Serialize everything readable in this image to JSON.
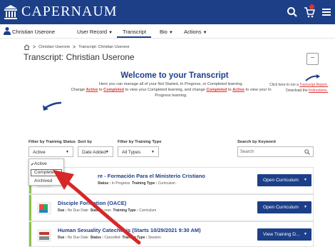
{
  "header": {
    "app_title": "CAPERNAUM",
    "colors": {
      "brand": "#1c3f88",
      "accent": "#e03131",
      "status_green": "#8bc34a"
    }
  },
  "subnav": {
    "user_name": "Christian Userone",
    "items": [
      {
        "label": "User Record",
        "has_menu": true
      },
      {
        "label": "Transcript",
        "has_menu": false
      },
      {
        "label": "Bio",
        "has_menu": true
      },
      {
        "label": "Actions",
        "has_menu": true
      }
    ]
  },
  "breadcrumb": {
    "items": [
      "Christian Userone",
      "Transcript: Christian Userone"
    ]
  },
  "page": {
    "title": "Transcript: Christian Userone",
    "collapse_label": "−"
  },
  "welcome": {
    "title": "Welcome to your Transcript",
    "line1": "Here you can manage all of your Not Started, In Progress, or Completed learning.",
    "p1": "Change ",
    "active": "Active",
    "p2": " to ",
    "completed": "Completed",
    "p3": " to view your Completed learning, and change ",
    "completed2": "Completed",
    "p4": " to ",
    "active2": "Active",
    "p5": " to view your In Progress learning.",
    "side_1": "Click here to run a ",
    "side_link1": "Transcript Report.",
    "side_2": "Download the ",
    "side_link2": "Instructions."
  },
  "filters": {
    "status_label": "Filter by Training Status",
    "status_value": "Active",
    "sort_label": "Sort by",
    "sort_value": "Date Added",
    "type_label": "Filter by Training Type",
    "type_value": "All Types",
    "search_label": "Search by Keyword",
    "search_placeholder": "Search"
  },
  "status_dropdown": {
    "options": [
      "Active",
      "Completed",
      "Archived"
    ],
    "selected": "Active"
  },
  "rows": [
    {
      "title": "re - Formación Para el Ministerio Cristiano",
      "due_label": "Due :",
      "due_value": "",
      "status_label": "Status :",
      "status_value": "In Progress",
      "type_label": "Training Type :",
      "type_value": "Curriculum",
      "button": "Open Curriculum"
    },
    {
      "title": "Disciple Formation (OACE)",
      "due_label": "Due :",
      "due_value": "No Due Date",
      "status_label": "Status :",
      "status_value": "ress",
      "type_label": "Training Type :",
      "type_value": "Curriculum",
      "button": "Open Curriculum"
    },
    {
      "title": "Human Sexuality Catechesis (Starts 10/29/2021 9:30 AM)",
      "due_label": "Due :",
      "due_value": "No Due Date",
      "status_label": "Status :",
      "status_value": "Cancelled",
      "type_label": "Training Type :",
      "type_value": "Session",
      "button": "View Training D..."
    }
  ]
}
